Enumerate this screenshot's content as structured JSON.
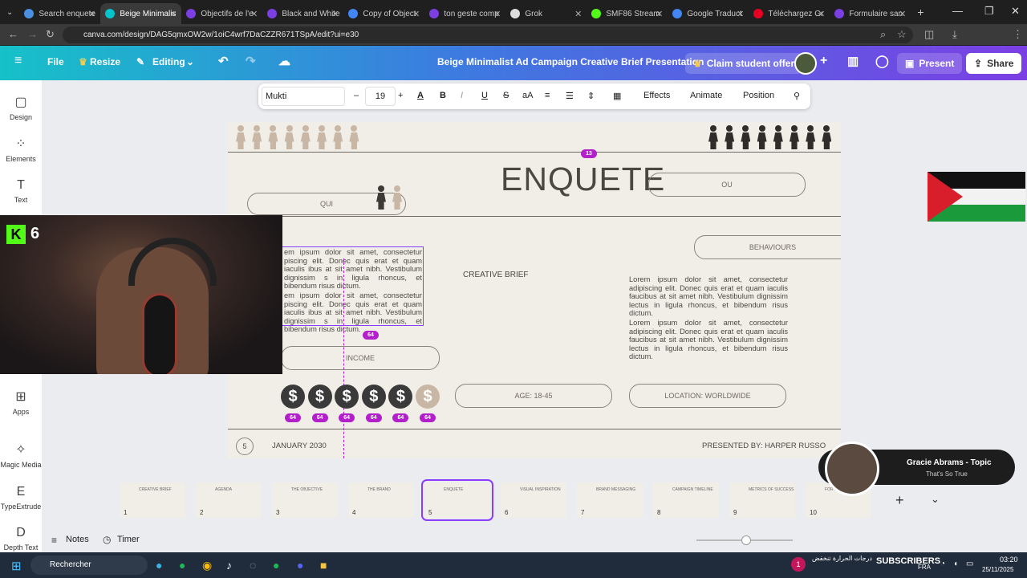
{
  "browser": {
    "tabs": [
      {
        "label": "Search enquete",
        "color": "#4a90e2"
      },
      {
        "label": "Beige Minimalis",
        "color": "#00c4cc",
        "active": true
      },
      {
        "label": "Objectifs de l'e",
        "color": "#7b3fe4"
      },
      {
        "label": "Black and White",
        "color": "#7b3fe4"
      },
      {
        "label": "Copy of Object",
        "color": "#4285f4"
      },
      {
        "label": "ton geste comp",
        "color": "#7b3fe4"
      },
      {
        "label": "Grok",
        "color": "#dddddd"
      },
      {
        "label": "SMF86 Stream",
        "color": "#53fc18"
      },
      {
        "label": "Google Traduct",
        "color": "#4285f4"
      },
      {
        "label": "Téléchargez Gr",
        "color": "#e60023"
      },
      {
        "label": "Formulaire san",
        "color": "#7b3fe4"
      }
    ],
    "url": "canva.com/design/DAG5qmxOW2w/1oiC4wrf7DaCZZR671TSpA/edit?ui=e30"
  },
  "canva": {
    "file": "File",
    "resize": "Resize",
    "mode": "Editing",
    "title": "Beige Minimalist Ad Campaign Creative Brief Presentation",
    "claim": "Claim student offer",
    "present": "Present",
    "share": "Share"
  },
  "sidebar": {
    "items": [
      {
        "label": "Design",
        "icon": "design-icon"
      },
      {
        "label": "Elements",
        "icon": "elements-icon"
      },
      {
        "label": "Text",
        "icon": "text-icon"
      },
      {
        "label": "Apps",
        "icon": "apps-icon"
      },
      {
        "label": "Magic Media",
        "icon": "magic-media-icon"
      },
      {
        "label": "TypeExtrude",
        "icon": "typeextrude-icon"
      },
      {
        "label": "Depth Text",
        "icon": "depth-text-icon"
      }
    ]
  },
  "toolbar": {
    "font": "Mukti",
    "size": "19",
    "minus": "–",
    "plus": "+",
    "effects": "Effects",
    "animate": "Animate",
    "position": "Position",
    "uppercase": "aA"
  },
  "slide": {
    "title": "ENQUETE",
    "qui": "QUI",
    "ou": "OU",
    "behaviours": "BEHAVIOURS",
    "creative_brief": "CREATIVE BRIEF",
    "lorem1": "Lorem ipsum dolor sit amet, consectetur adipiscing elit. Donec quis erat et quam iaculis faucibus at sit amet nibh. Vestibulum dignissim lectus in ligula rhoncus, et bibendum risus dictum.",
    "lorem_left": "em ipsum dolor sit amet, consectetur piscing elit. Donec quis erat et quam iaculis ibus at sit amet nibh. Vestibulum dignissim s in ligula rhoncus, et bibendum risus dictum.",
    "income": "INCOME",
    "age": "AGE: 18-45",
    "location": "LOCATION: WORLDWIDE",
    "page": "5",
    "date": "JANUARY 2030",
    "presented": "PRESENTED BY: HARPER RUSSO",
    "badge13": "13",
    "badge64": "64",
    "dollar": "$"
  },
  "thumbs": [
    {
      "n": "1",
      "t": "CREATIVE BRIEF"
    },
    {
      "n": "2",
      "t": "AGENDA"
    },
    {
      "n": "3",
      "t": "THE OBJECTIVE"
    },
    {
      "n": "4",
      "t": "THE BRAND"
    },
    {
      "n": "5",
      "t": "ENQUETE"
    },
    {
      "n": "6",
      "t": "VISUAL INSPIRATION"
    },
    {
      "n": "7",
      "t": "BRAND MESSAGING"
    },
    {
      "n": "8",
      "t": "CAMPAIGN TIMELINE"
    },
    {
      "n": "9",
      "t": "METRICS OF SUCCESS"
    },
    {
      "n": "10",
      "t": "FOR MORE"
    }
  ],
  "bottom": {
    "notes": "Notes",
    "timer": "Timer"
  },
  "overlay": {
    "kick": "6",
    "song_title": "Gracie Abrams - Topic",
    "song_sub": "That's So True",
    "subscribers": "SUBSCRIBERS"
  },
  "taskbar": {
    "search": "Rechercher",
    "time": "03:20",
    "date": "25/11/2025",
    "lang": "FRA",
    "weather": "درجات الحرارة تنخفض",
    "notif": "1"
  }
}
